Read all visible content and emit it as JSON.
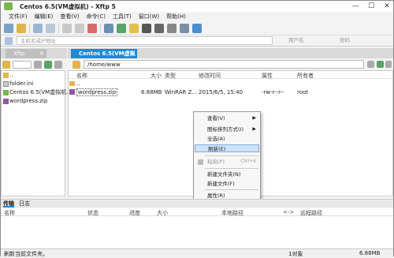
{
  "window": {
    "title": "Centos 6.5(VM虚拟机)  - Xftp 5",
    "min": "—",
    "max": "☐",
    "close": "✕"
  },
  "menu": [
    "文件(F)",
    "编辑(E)",
    "查看(V)",
    "命令(C)",
    "工具(T)",
    "窗口(W)",
    "帮助(H)"
  ],
  "address": {
    "host_placeholder": "主机名或IP地址",
    "user_placeholder": "用户名",
    "pass_placeholder": "密码"
  },
  "tabs": {
    "local": "Xftp",
    "remote": "Centos 6.5(VM虚拟机)",
    "close": "✕"
  },
  "remote_path": "/home/www",
  "local_items": [
    {
      "name": ".."
    },
    {
      "name": "folder.ini"
    },
    {
      "name": "Centos 6.5(VM虚拟机..."
    },
    {
      "name": "wordpress.zip"
    }
  ],
  "columns": {
    "name": "名称",
    "size": "大小",
    "type": "类型",
    "modified": "修改时间",
    "attr": "属性",
    "owner": "所有者"
  },
  "remote_items": [
    {
      "name": "..",
      "size": "",
      "type": "",
      "modified": "",
      "attr": "",
      "owner": ""
    },
    {
      "name": "wordpress.zip",
      "size": "6.88MB",
      "type": "WinRAR Z...",
      "modified": "2015/6/5, 15:40",
      "attr": "-rw-r--r--",
      "owner": "root"
    }
  ],
  "context_menu": [
    {
      "label": "查看(V)",
      "arrow": "▶"
    },
    {
      "label": "图标排列方式(I)",
      "arrow": "▶"
    },
    {
      "label": "全选(A)"
    },
    {
      "label": "刷新(E)"
    },
    {
      "label": "粘贴(P)",
      "shortcut": "Ctrl+V"
    },
    {
      "label": "新建文件夹(N)"
    },
    {
      "label": "新建文件(F)"
    },
    {
      "label": "属性(R)"
    }
  ],
  "bottom_tabs": [
    "传输",
    "日志"
  ],
  "transfer_columns": {
    "name": "名称",
    "status": "状态",
    "progress": "进度",
    "size": "大小",
    "local": "本地路径",
    "arrow": "<->",
    "remote": "远程路径"
  },
  "status": {
    "left": "刷新当前文件夹。",
    "count": "1对象",
    "size": "6.88MB"
  }
}
